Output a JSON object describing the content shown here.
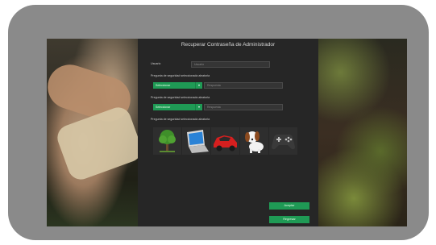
{
  "dialog": {
    "title": "Recuperar Contraseña de Administrador",
    "user_label": "Usuario",
    "user_placeholder": "Usuario",
    "q1_label": "Pregunta de seguridad seleccionada aleatoria",
    "q1_select": "Seleccionar",
    "q1_answer_placeholder": "Respuesta",
    "q2_label": "Pregunta de seguridad seleccionada aleatoria",
    "q2_select": "Seleccionar",
    "q2_answer_placeholder": "Respuesta",
    "picture_label": "Pregunta de seguridad seleccionada aleatoria",
    "pictures": [
      "tree",
      "laptop",
      "car",
      "dog",
      "gamepad"
    ],
    "confirm_button": "Aceptar",
    "back_button": "Regresar"
  },
  "colors": {
    "accent": "#1f9a55",
    "panel": "#262626",
    "frame": "#8a8a8a"
  }
}
